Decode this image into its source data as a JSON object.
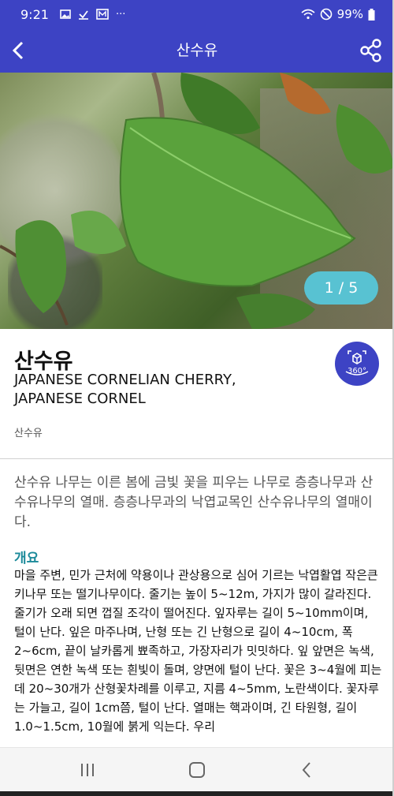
{
  "status_bar": {
    "time": "9:21",
    "more": "···",
    "battery": "99%"
  },
  "app_bar": {
    "title": "산수유"
  },
  "gallery": {
    "counter": "1 / 5"
  },
  "plant": {
    "name_ko": "산수유",
    "name_en_line1": "JAPANESE CORNELIAN CHERRY,",
    "name_en_line2": "JAPANESE CORNEL",
    "alias": "산수유",
    "view360_label": "360°"
  },
  "summary": "산수유 나무는 이른 봄에 금빛 꽃을 피우는 나무로 층층나무과 산수유나무의 열매. 층층나무과의 낙엽교목인 산수유나무의 열매이다.",
  "section": {
    "heading": "개요",
    "body": "마을 주변, 민가 근처에 약용이나 관상용으로 심어 기르는 낙엽활엽 작은큰키나무 또는 떨기나무이다. 줄기는 높이 5~12m, 가지가 많이 갈라진다. 줄기가 오래 되면 껍질 조각이 떨어진다. 잎자루는 길이 5~10mm이며, 털이 난다. 잎은 마주나며, 난형 또는 긴 난형으로 길이 4~10cm, 폭 2~6cm, 끝이 날카롭게 뾰족하고, 가장자리가 밋밋하다. 잎 앞면은 녹색, 뒷면은 연한 녹색 또는 흰빛이 돌며, 양면에 털이 난다. 꽃은 3~4월에 피는데 20~30개가 산형꽃차례를 이루고, 지름 4~5mm, 노란색이다. 꽃자루는 가늘고, 길이 1cm쯤, 털이 난다. 열매는 핵과이며, 긴 타원형, 길이 1.0~1.5cm, 10월에 붉게 익는다. 우리"
  },
  "colors": {
    "primary": "#3d43c4",
    "counter_bg": "#58c2d2",
    "section_heading": "#1b8a9a"
  },
  "icons": [
    "back-arrow-icon",
    "share-icon",
    "view-360-icon",
    "wifi-icon",
    "mute-icon",
    "battery-icon",
    "image-icon",
    "download-icon",
    "gallery-icon",
    "recents-icon",
    "home-icon",
    "nav-back-icon"
  ]
}
